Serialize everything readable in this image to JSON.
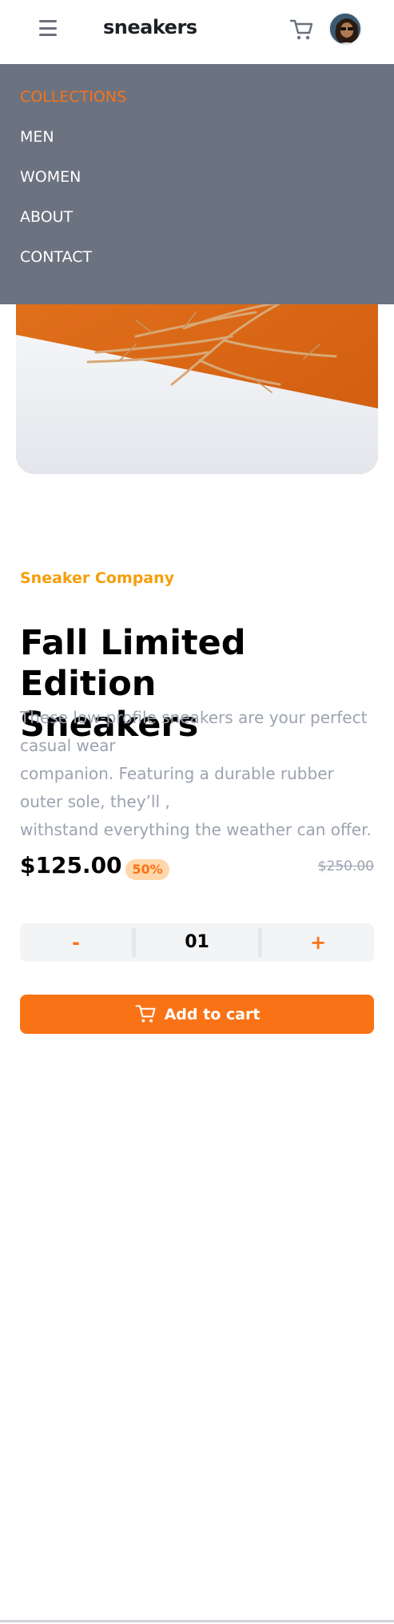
{
  "header": {
    "logo": "sneakers",
    "menu_icon": "hamburger-icon",
    "cart_icon": "cart-icon",
    "avatar_icon": "avatar"
  },
  "nav": {
    "items": [
      {
        "label": "COLLECTIONS",
        "active": true
      },
      {
        "label": "MEN",
        "active": false
      },
      {
        "label": "WOMEN",
        "active": false
      },
      {
        "label": "ABOUT",
        "active": false
      },
      {
        "label": "CONTACT",
        "active": false
      }
    ]
  },
  "product": {
    "company": "Sneaker Company",
    "title_line1": "Fall Limited Edition",
    "title_line2": "Sneakers",
    "description_lines": [
      "These low-profile sneakers are your perfect",
      "casual wear",
      "companion. Featuring a durable rubber",
      "outer sole, they’ll ,",
      "withstand everything the weather can offer."
    ],
    "price": "$125.00",
    "discount": "50%",
    "old_price": "$250.00"
  },
  "quantity": {
    "minus": "-",
    "value": "01",
    "plus": "+"
  },
  "cta": {
    "label": "Add to cart"
  },
  "colors": {
    "accent": "#f97316",
    "company": "#f59e0b",
    "nav_bg": "#6b7280",
    "muted": "#9ca3af"
  }
}
